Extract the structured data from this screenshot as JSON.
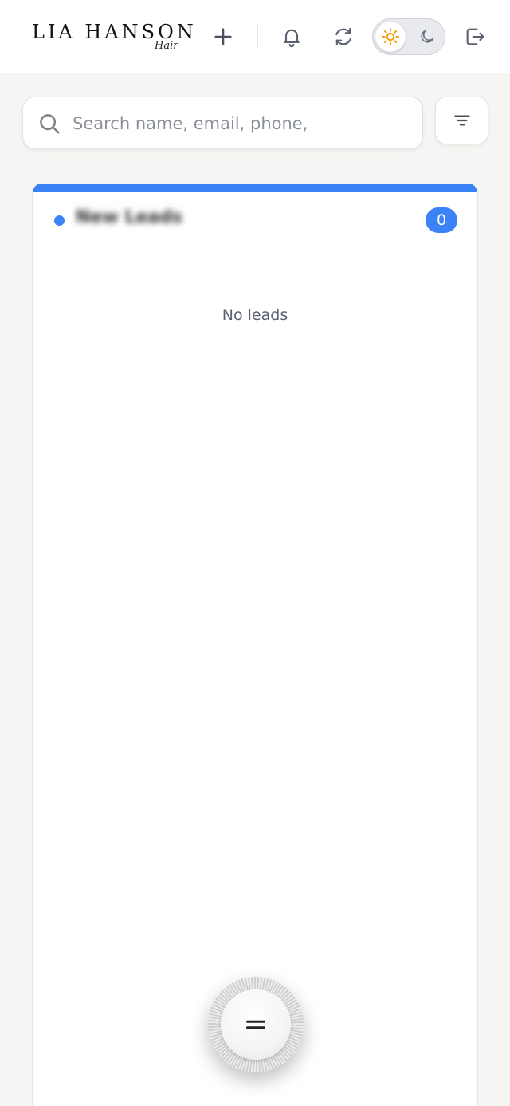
{
  "header": {
    "logo_text": "LIA HANSON",
    "logo_script": "Hair",
    "icons": [
      "plus-icon",
      "bell-icon",
      "refresh-icon",
      "sun-icon",
      "moon-icon",
      "logout-icon"
    ]
  },
  "search": {
    "placeholder": "Search name, email, phone,",
    "value": ""
  },
  "column": {
    "title": "New Leads",
    "count": "0",
    "empty_text": "No leads",
    "accent_color": "#3b82f6"
  },
  "theme": {
    "mode": "light",
    "sun_color": "#f59e0b"
  }
}
